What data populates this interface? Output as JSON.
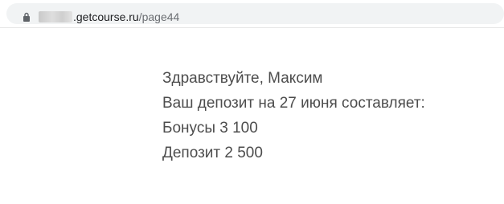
{
  "browser": {
    "url_domain": ".getcourse.ru",
    "url_path": "/page44",
    "lock_icon": "lock-icon"
  },
  "message": {
    "greeting": "Здравствуйте, Максим",
    "deposit_intro": "Ваш депозит на 27 июня составляет:",
    "bonus_line": "Бонусы 3 100",
    "deposit_line": "Депозит 2 500"
  }
}
